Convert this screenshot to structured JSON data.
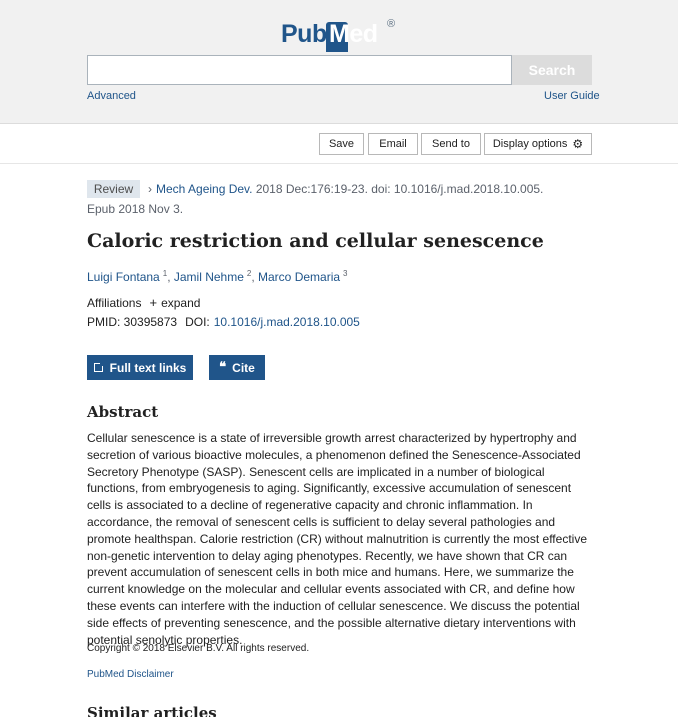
{
  "header": {
    "logo_pub": "Pub",
    "logo_med": "Med",
    "logo_reg": "®",
    "search_value": "",
    "search_button": "Search",
    "advanced": "Advanced",
    "user_guide": "User Guide"
  },
  "toolbar": {
    "save": "Save",
    "email": "Email",
    "send_to": "Send to",
    "display_options": "Display options"
  },
  "article": {
    "badge": "Review",
    "journal": "Mech Ageing Dev.",
    "citation_rest": " 2018 Dec:176:19-23. doi: 10.1016/j.mad.2018.10.005.",
    "epub": "Epub 2018 Nov 3.",
    "title": "Caloric restriction and cellular senescence",
    "authors": [
      {
        "name": "Luigi Fontana",
        "aff": "1"
      },
      {
        "name": "Jamil Nehme",
        "aff": "2"
      },
      {
        "name": "Marco Demaria",
        "aff": "3"
      }
    ],
    "affiliations_label": "Affiliations",
    "expand": "expand",
    "pmid": "PMID: 30395873",
    "doi_label": "DOI:",
    "doi": "10.1016/j.mad.2018.10.005"
  },
  "actions": {
    "full_text": "Full text links",
    "cite": "Cite"
  },
  "abstract": {
    "heading": "Abstract",
    "text": "Cellular senescence is a state of irreversible growth arrest characterized by hypertrophy and secretion of various bioactive molecules, a phenomenon defined the Senescence-Associated Secretory Phenotype (SASP). Senescent cells are implicated in a number of biological functions, from embryogenesis to aging. Significantly, excessive accumulation of senescent cells is associated to a decline of regenerative capacity and chronic inflammation. In accordance, the removal of senescent cells is sufficient to delay several pathologies and promote healthspan. Calorie restriction (CR) without malnutrition is currently the most effective non-genetic intervention to delay aging phenotypes. Recently, we have shown that CR can prevent accumulation of senescent cells in both mice and humans. Here, we summarize the current knowledge on the molecular and cellular events associated with CR, and define how these events can interfere with the induction of cellular senescence. We discuss the potential side effects of preventing senescence, and the possible alternative dietary interventions with potential senolytic properties.",
    "copyright": "Copyright © 2018 Elsevier B.V. All rights reserved.",
    "disclaimer": "PubMed Disclaimer"
  },
  "similar": {
    "heading": "Similar articles"
  },
  "colors": {
    "brand": "#20558a",
    "header_bg": "#f1f1f1",
    "badge_bg": "#dfe6ed"
  },
  "icons": {
    "display_options": "gear-icon",
    "full_text": "external-link-icon",
    "cite": "quote-icon",
    "citation": "chevron-right-icon",
    "affiliations": "plus-icon"
  }
}
